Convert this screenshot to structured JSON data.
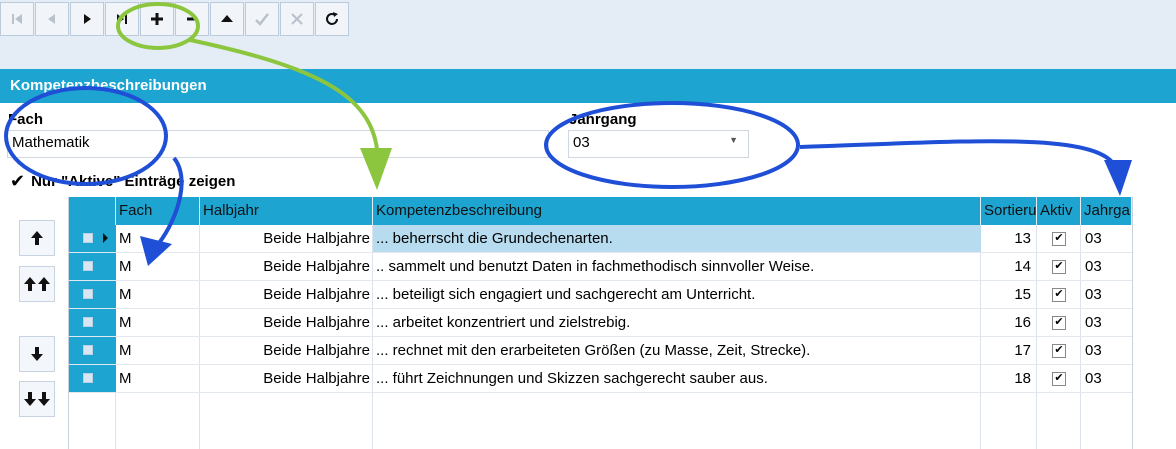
{
  "toolbar": {
    "buttons": [
      {
        "icon": "first-record-icon",
        "enabled": false
      },
      {
        "icon": "previous-record-icon",
        "enabled": false
      },
      {
        "icon": "next-record-icon",
        "enabled": true
      },
      {
        "icon": "last-record-icon",
        "enabled": true
      },
      {
        "icon": "plus-icon",
        "enabled": true
      },
      {
        "icon": "minus-icon",
        "enabled": true
      },
      {
        "icon": "triangle-up-icon",
        "enabled": true
      },
      {
        "icon": "checkmark-icon",
        "enabled": false
      },
      {
        "icon": "cross-icon",
        "enabled": false
      },
      {
        "icon": "refresh-icon",
        "enabled": true
      }
    ]
  },
  "panel": {
    "title": "Kompetenzbeschreibungen",
    "fach_label": "Fach",
    "fach_value": "Mathematik",
    "jahrgang_label": "Jahrgang",
    "jahrgang_value": "03",
    "filter_label": "Nur \"Aktive\" Einträge zeigen",
    "filter_checked": true
  },
  "side_buttons": [
    {
      "icon": "move-up-icon"
    },
    {
      "icon": "move-to-top-icon"
    },
    {
      "icon": "move-down-icon"
    },
    {
      "icon": "move-to-bottom-icon"
    }
  ],
  "grid": {
    "columns": [
      "Fach",
      "Halbjahr",
      "Kompetenzbeschreibung",
      "Sortieru",
      "Aktiv",
      "Jahrga"
    ],
    "rows": [
      {
        "fach": "M",
        "halbjahr": "Beide Halbjahre",
        "text": "... beherrscht die Grundechenarten.",
        "sort": "13",
        "aktiv": true,
        "jahrgang": "03"
      },
      {
        "fach": "M",
        "halbjahr": "Beide Halbjahre",
        "text": ".. sammelt und benutzt Daten in fachmethodisch sinnvoller Weise.",
        "sort": "14",
        "aktiv": true,
        "jahrgang": "03"
      },
      {
        "fach": "M",
        "halbjahr": "Beide Halbjahre",
        "text": "... beteiligt sich engagiert und sachgerecht am Unterricht.",
        "sort": "15",
        "aktiv": true,
        "jahrgang": "03"
      },
      {
        "fach": "M",
        "halbjahr": "Beide Halbjahre",
        "text": "... arbeitet konzentriert und zielstrebig.",
        "sort": "16",
        "aktiv": true,
        "jahrgang": "03"
      },
      {
        "fach": "M",
        "halbjahr": "Beide Halbjahre",
        "text": "... rechnet mit den erarbeiteten Größen (zu Masse, Zeit, Strecke).",
        "sort": "17",
        "aktiv": true,
        "jahrgang": "03"
      },
      {
        "fach": "M",
        "halbjahr": "Beide Halbjahre",
        "text": "... führt Zeichnungen und Skizzen sachgerecht sauber aus.",
        "sort": "18",
        "aktiv": true,
        "jahrgang": "03"
      }
    ]
  },
  "colors": {
    "accent": "#1ea4d0",
    "annotation_green": "#8cc63f",
    "annotation_blue": "#1f4fd6"
  }
}
